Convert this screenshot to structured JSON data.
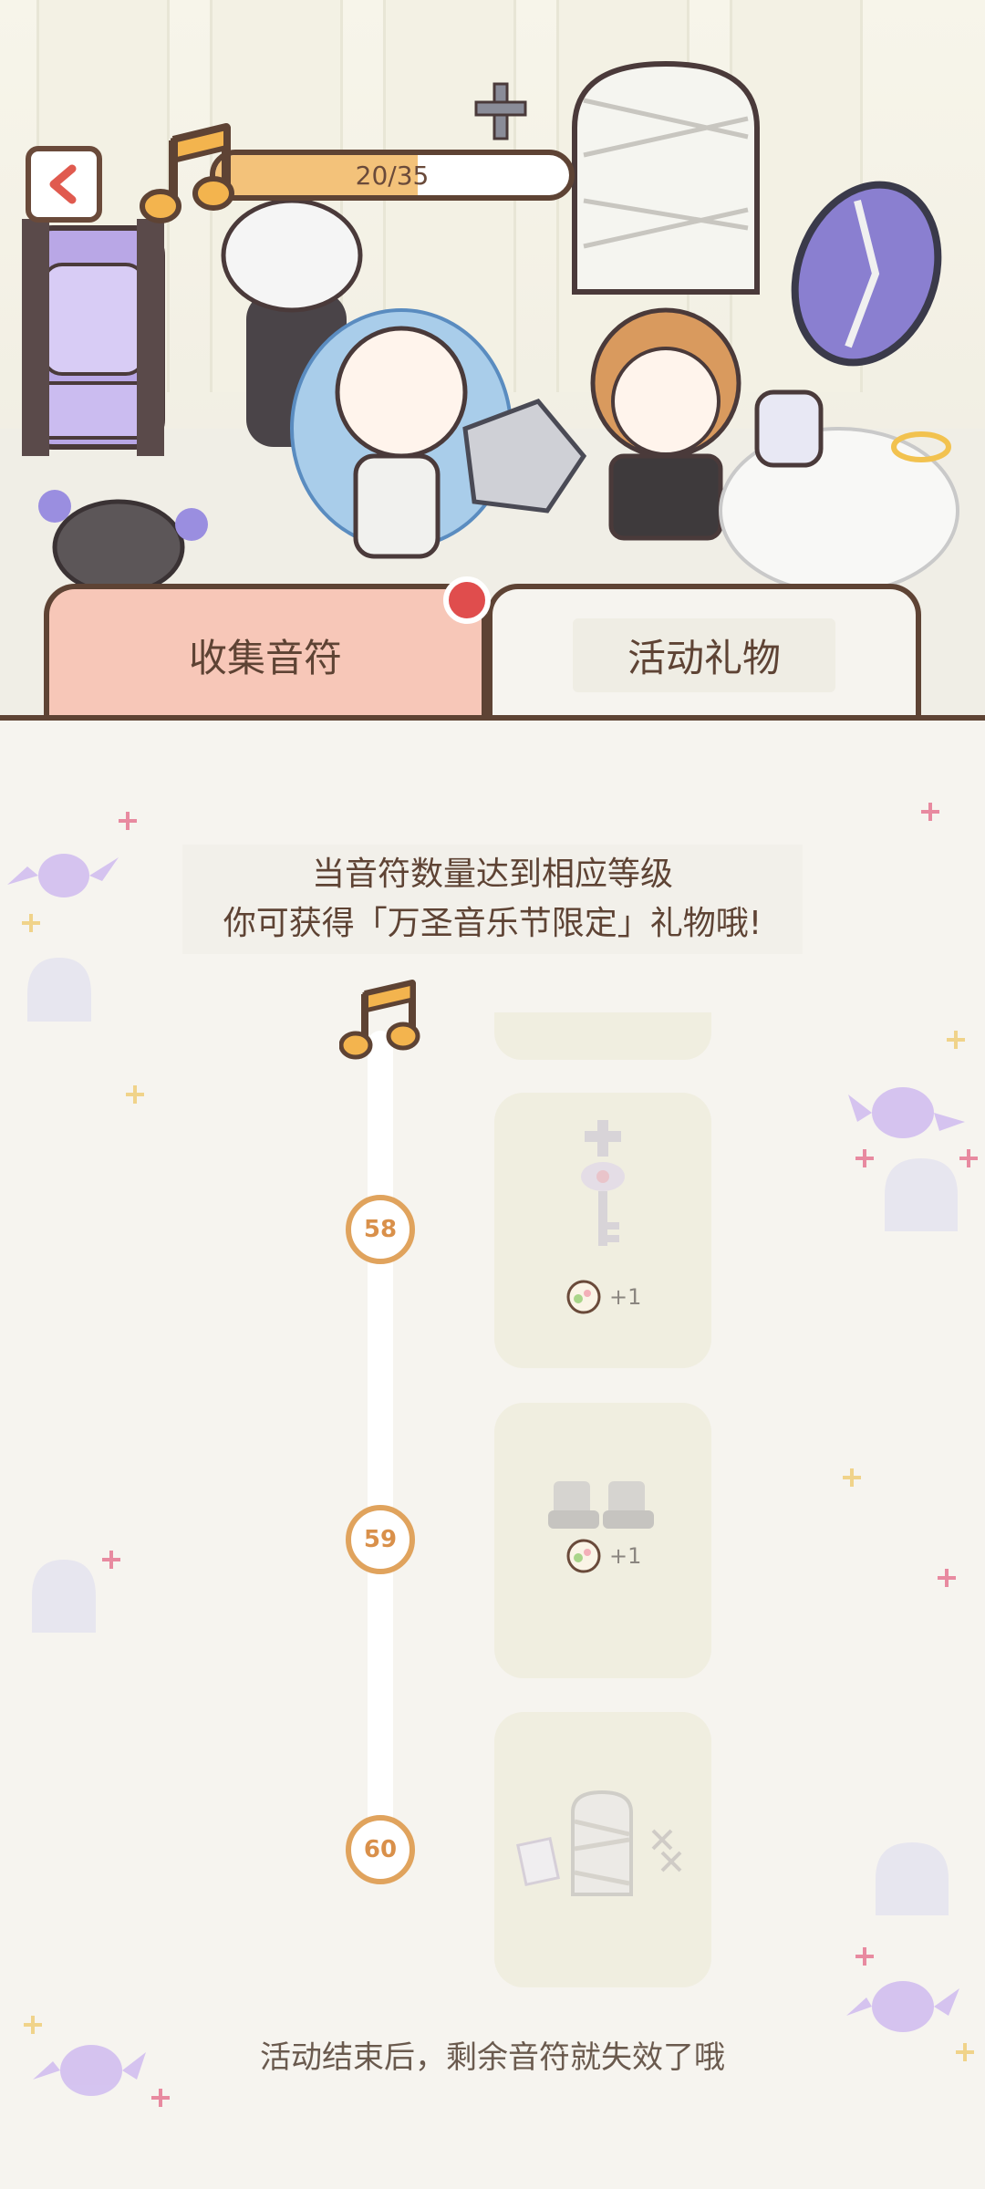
{
  "header": {
    "back_label": "<",
    "progress": {
      "text": "20/35",
      "current": 20,
      "total": 35
    }
  },
  "tabs": [
    {
      "label": "收集音符",
      "active": true
    },
    {
      "label": "活动礼物",
      "active": false
    }
  ],
  "intro": {
    "line1": "当音符数量达到相应等级",
    "line2": "你可获得「万圣音乐节限定」礼物哦!"
  },
  "levels": [
    {
      "level": "58",
      "reward_icon": "cross-key-icon",
      "bonus": "+1"
    },
    {
      "level": "59",
      "reward_icon": "bandage-boots-icon",
      "bonus": "+1"
    },
    {
      "level": "60",
      "reward_icon": "mummy-wardrobe-icon",
      "bonus": ""
    }
  ],
  "footer": {
    "text": "活动结束后，剩余音符就失效了哦"
  },
  "colors": {
    "accent": "#f3c27a",
    "outline": "#5e4334",
    "tab_active": "#f7c7b8",
    "badge": "#e04d4d",
    "level_ring": "#e0a35d"
  }
}
